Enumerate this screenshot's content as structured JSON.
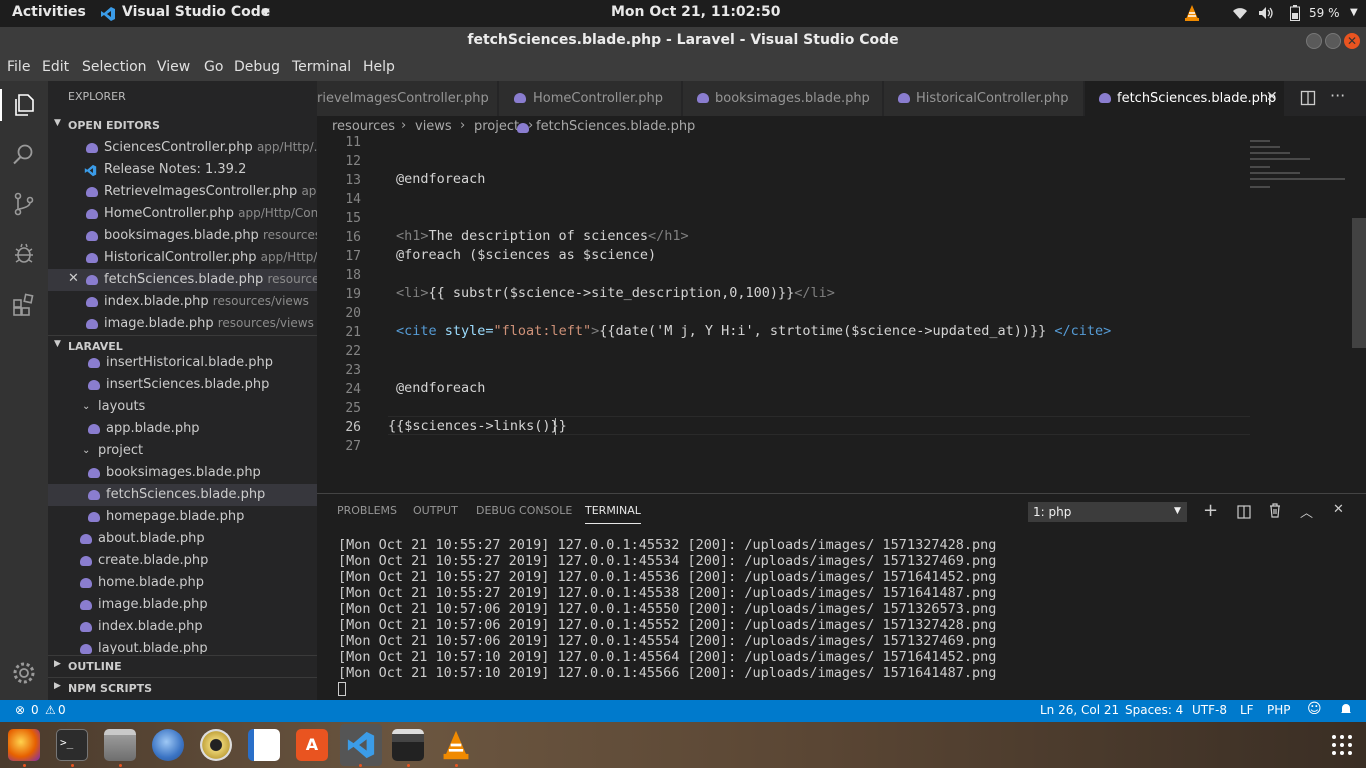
{
  "topbar": {
    "activities": "Activities",
    "app_name": "Visual Studio Code",
    "clock": "Mon Oct 21, 11:02:50",
    "battery": "59 %"
  },
  "window": {
    "title": "fetchSciences.blade.php - Laravel - Visual Studio Code"
  },
  "menu": [
    "File",
    "Edit",
    "Selection",
    "View",
    "Go",
    "Debug",
    "Terminal",
    "Help"
  ],
  "activity_icons": [
    "explorer-icon",
    "search-icon",
    "source-control-icon",
    "debug-icon",
    "extensions-icon",
    "settings-gear-icon"
  ],
  "sidebar": {
    "title": "EXPLORER",
    "open_editors": {
      "label": "OPEN EDITORS",
      "items": [
        {
          "name": "SciencesController.php",
          "path": "app/Http/..."
        },
        {
          "name": "Release Notes: 1.39.2",
          "path": ""
        },
        {
          "name": "RetrieveImagesController.php",
          "path": "ap..."
        },
        {
          "name": "HomeController.php",
          "path": "app/Http/Con..."
        },
        {
          "name": "booksimages.blade.php",
          "path": "resources..."
        },
        {
          "name": "HistoricalController.php",
          "path": "app/Http/..."
        },
        {
          "name": "fetchSciences.blade.php",
          "path": "resource..."
        },
        {
          "name": "index.blade.php",
          "path": "resources/views"
        },
        {
          "name": "image.blade.php",
          "path": "resources/views"
        }
      ]
    },
    "laravel": {
      "label": "LARAVEL",
      "items": [
        {
          "name": "insertHistorical.blade.php"
        },
        {
          "name": "insertSciences.blade.php"
        },
        {
          "name": "layouts"
        },
        {
          "name": "app.blade.php"
        },
        {
          "name": "project"
        },
        {
          "name": "booksimages.blade.php"
        },
        {
          "name": "fetchSciences.blade.php"
        },
        {
          "name": "homepage.blade.php"
        },
        {
          "name": "about.blade.php"
        },
        {
          "name": "create.blade.php"
        },
        {
          "name": "home.blade.php"
        },
        {
          "name": "image.blade.php"
        },
        {
          "name": "index.blade.php"
        },
        {
          "name": "layout.blade.php"
        }
      ]
    },
    "outline": "OUTLINE",
    "npm": "NPM SCRIPTS"
  },
  "tabs": [
    "rieveImagesController.php",
    "HomeController.php",
    "booksimages.blade.php",
    "HistoricalController.php",
    "fetchSciences.blade.php"
  ],
  "breadcrumb": [
    "resources",
    "views",
    "project",
    "fetchSciences.blade.php"
  ],
  "editor": {
    "line_numbers": [
      "11",
      "12",
      "13",
      "14",
      "15",
      "16",
      "17",
      "18",
      "19",
      "20",
      "21",
      "22",
      "23",
      "24",
      "25",
      "26",
      "27"
    ],
    "code": {
      "l13": "@endforeach",
      "l16_tag_open": "<h1>",
      "l16_text": "The description of sciences",
      "l16_tag_close": "</h1>",
      "l17": "@foreach ($sciences as $science)",
      "l19_tag_open": "<li>",
      "l19_text": "{{ substr($science->site_description,0,100)}}",
      "l19_tag_close": "</li>",
      "l21_open": "<cite",
      "l21_attr": " style=",
      "l21_val": "\"float:left\"",
      "l21_gt": ">",
      "l21_text": "{{date('M j, Y H:i', strtotime($science->updated_at))}} ",
      "l21_close": "</cite>",
      "l24": "@endforeach",
      "l26": "{{$sciences->links()}}"
    }
  },
  "panel": {
    "tabs": [
      "PROBLEMS",
      "OUTPUT",
      "DEBUG CONSOLE",
      "TERMINAL"
    ],
    "terminal_select": "1: php",
    "lines": [
      "[Mon Oct 21 10:55:27 2019] 127.0.0.1:45532 [200]: /uploads/images/ 1571327428.png",
      "[Mon Oct 21 10:55:27 2019] 127.0.0.1:45534 [200]: /uploads/images/ 1571327469.png",
      "[Mon Oct 21 10:55:27 2019] 127.0.0.1:45536 [200]: /uploads/images/ 1571641452.png",
      "[Mon Oct 21 10:55:27 2019] 127.0.0.1:45538 [200]: /uploads/images/ 1571641487.png",
      "[Mon Oct 21 10:57:06 2019] 127.0.0.1:45550 [200]: /uploads/images/ 1571326573.png",
      "[Mon Oct 21 10:57:06 2019] 127.0.0.1:45552 [200]: /uploads/images/ 1571327428.png",
      "[Mon Oct 21 10:57:06 2019] 127.0.0.1:45554 [200]: /uploads/images/ 1571327469.png",
      "[Mon Oct 21 10:57:10 2019] 127.0.0.1:45564 [200]: /uploads/images/ 1571641452.png",
      "[Mon Oct 21 10:57:10 2019] 127.0.0.1:45566 [200]: /uploads/images/ 1571641487.png"
    ]
  },
  "status": {
    "problems": "0",
    "warnings": "0",
    "position": "Ln 26, Col 21",
    "spaces": "Spaces: 4",
    "encoding": "UTF-8",
    "eol": "LF",
    "language": "PHP"
  },
  "dock_icons": [
    "firefox-icon",
    "terminal-icon",
    "files-icon",
    "thunderbird-icon",
    "rhythmbox-icon",
    "libreoffice-writer-icon",
    "software-center-icon",
    "vscode-icon",
    "video-editor-icon",
    "vlc-icon"
  ],
  "colors": {
    "accent": "#007acc",
    "sidebar": "#252526",
    "editor": "#1e1e1e",
    "selection": "#37373d"
  }
}
